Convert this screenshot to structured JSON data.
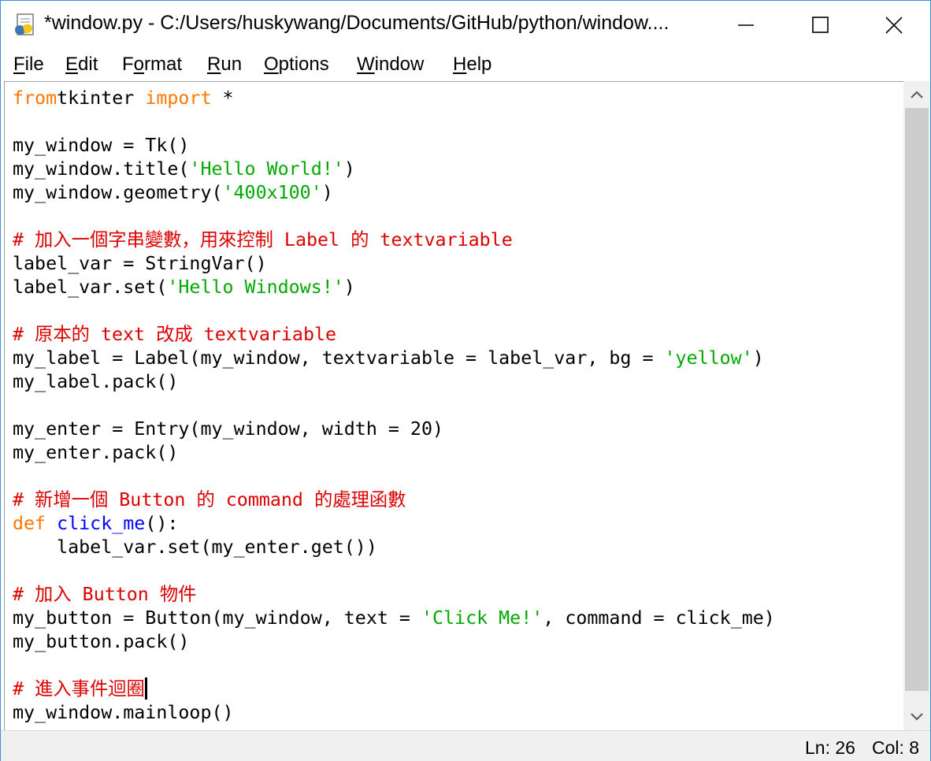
{
  "window": {
    "title": "*window.py - C:/Users/huskywang/Documents/GitHub/python/window....",
    "controls": {
      "minimize": "minimize",
      "maximize": "maximize",
      "close": "close"
    }
  },
  "menu": [
    {
      "u": "F",
      "rest": "ile"
    },
    {
      "u": "E",
      "rest": "dit"
    },
    {
      "pre": "F",
      "u": "o",
      "rest": "rmat"
    },
    {
      "u": "R",
      "rest": "un"
    },
    {
      "u": "O",
      "rest": "ptions"
    },
    {
      "u": "W",
      "rest": "indow"
    },
    {
      "u": "H",
      "rest": "elp"
    }
  ],
  "code": [
    [
      [
        "kw",
        "from"
      ],
      [
        "",
        "tkinter "
      ],
      [
        "kw",
        "import"
      ],
      [
        "",
        " *"
      ]
    ],
    [],
    [
      [
        "",
        "my_window = Tk()"
      ]
    ],
    [
      [
        "",
        "my_window.title("
      ],
      [
        "str",
        "'Hello World!'"
      ],
      [
        "",
        ")"
      ]
    ],
    [
      [
        "",
        "my_window.geometry("
      ],
      [
        "str",
        "'400x100'"
      ],
      [
        "",
        ")"
      ]
    ],
    [],
    [
      [
        "cmt",
        "# 加入一個字串變數，用來控制 Label 的 textvariable"
      ]
    ],
    [
      [
        "",
        "label_var = StringVar()"
      ]
    ],
    [
      [
        "",
        "label_var.set("
      ],
      [
        "str",
        "'Hello Windows!'"
      ],
      [
        "",
        ")"
      ]
    ],
    [],
    [
      [
        "cmt",
        "# 原本的 text 改成 textvariable"
      ]
    ],
    [
      [
        "",
        "my_label = Label(my_window, textvariable = label_var, bg = "
      ],
      [
        "str",
        "'yellow'"
      ],
      [
        "",
        ")"
      ]
    ],
    [
      [
        "",
        "my_label.pack()"
      ]
    ],
    [],
    [
      [
        "",
        "my_enter = Entry(my_window, width = 20)"
      ]
    ],
    [
      [
        "",
        "my_enter.pack()"
      ]
    ],
    [],
    [
      [
        "cmt",
        "# 新增一個 Button 的 command 的處理函數"
      ]
    ],
    [
      [
        "kw",
        "def"
      ],
      [
        "",
        " "
      ],
      [
        "def",
        "click_me"
      ],
      [
        "",
        "():"
      ]
    ],
    [
      [
        "",
        "    label_var.set(my_enter.get())"
      ]
    ],
    [],
    [
      [
        "cmt",
        "# 加入 Button 物件"
      ]
    ],
    [
      [
        "",
        "my_button = Button(my_window, text = "
      ],
      [
        "str",
        "'Click Me!'"
      ],
      [
        "",
        ", command = click_me)"
      ]
    ],
    [
      [
        "",
        "my_button.pack()"
      ]
    ],
    [],
    [
      [
        "cmt",
        "# 進入事件迴圈"
      ],
      [
        "caret",
        ""
      ]
    ],
    [
      [
        "",
        "my_window.mainloop()"
      ]
    ]
  ],
  "status": {
    "line": "Ln: 26",
    "col": "Col: 8"
  },
  "colors": {
    "keyword": "#ff7700",
    "string": "#00aa00",
    "comment": "#dd0000",
    "definition": "#0000ff"
  },
  "icons": {
    "app": "python-idle-icon",
    "scroll_up": "chevron-up-icon",
    "scroll_down": "chevron-down-icon"
  }
}
